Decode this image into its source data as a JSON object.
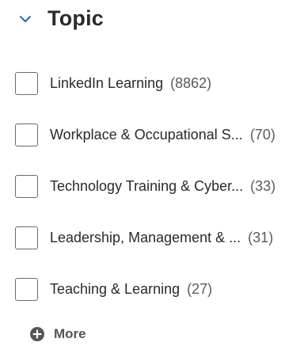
{
  "section": {
    "title": "Topic",
    "toggle_icon": "chevron-down-icon",
    "accent_color": "#2b66c9"
  },
  "items": [
    {
      "name": "LinkedIn Learning",
      "count": "(8862)",
      "checked": false
    },
    {
      "name": "Workplace & Occupational S...",
      "count": "(70)",
      "checked": false
    },
    {
      "name": "Technology Training & Cyber...",
      "count": "(33)",
      "checked": false
    },
    {
      "name": "Leadership, Management & ...",
      "count": "(31)",
      "checked": false
    },
    {
      "name": "Teaching & Learning",
      "count": "(27)",
      "checked": false
    }
  ],
  "more": {
    "label": "More",
    "icon": "plus-circle-icon"
  }
}
